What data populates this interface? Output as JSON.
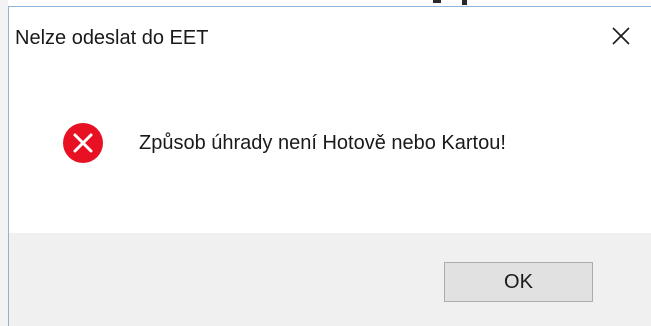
{
  "dialog": {
    "title": "Nelze odeslat do EET",
    "message": "Způsob úhrady není Hotově nebo Kartou!",
    "ok_label": "OK",
    "close_icon": "close-icon",
    "status_icon": "error-icon"
  },
  "colors": {
    "error_red": "#e81123",
    "footer_bg": "#f0f0f0",
    "button_bg": "#e1e1e1",
    "button_border": "#adadad",
    "border_accent": "#8fb3d9"
  }
}
